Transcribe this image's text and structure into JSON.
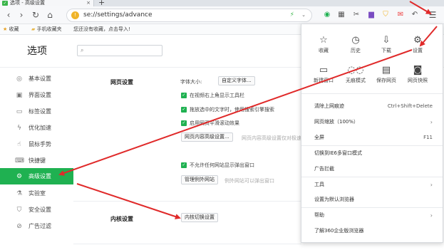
{
  "tab": {
    "title": "选项 - 高级设置",
    "close": "×",
    "new_tab": "+"
  },
  "toolbar": {
    "url": "se://settings/advance",
    "bolt": "⚡",
    "caret": "⌄",
    "icons": [
      "translate-icon",
      "scissors-icon",
      "menu-icon"
    ]
  },
  "bookmarks": {
    "favorites": "收藏",
    "mobile": "手机收藏夹",
    "hint": "您还没有收藏，点击导入!"
  },
  "page": {
    "title": "选项",
    "search_placeholder": ""
  },
  "sidebar": {
    "items": [
      {
        "label": "基本设置",
        "icon": "◎"
      },
      {
        "label": "界面设置",
        "icon": "▣"
      },
      {
        "label": "标签设置",
        "icon": "▭"
      },
      {
        "label": "优化加速",
        "icon": "ϟ"
      },
      {
        "label": "鼠标手势",
        "icon": "☝"
      },
      {
        "label": "快捷键",
        "icon": "⌨"
      },
      {
        "label": "高级设置",
        "icon": "⚙"
      },
      {
        "label": "实验室",
        "icon": "⚗"
      },
      {
        "label": "安全设置",
        "icon": "⛉"
      },
      {
        "label": "广告过滤",
        "icon": "⊘"
      }
    ]
  },
  "web_settings": {
    "title": "网页设置",
    "font_size_label": "字体大小:",
    "custom_font_btn": "自定义字体...",
    "checkboxes": [
      "在视频右上角显示工具栏",
      "拖放选中的文字时，使用搜索引擎搜索",
      "启用网页平滑滚动效果"
    ],
    "content_btn": "网页内容高级设置...",
    "content_hint": "网页内容高级设置仅对极速",
    "popup_checkbox": "不允许任何网站显示弹出窗口",
    "exceptions_btn": "管理例外网站",
    "exceptions_hint": "例外网站可以弹出窗口"
  },
  "kernel_settings": {
    "title": "内核设置",
    "switch_btn": "内核切换设置"
  },
  "menu": {
    "quick": [
      {
        "label": "收藏",
        "icon": "☆"
      },
      {
        "label": "历史",
        "icon": "◷"
      },
      {
        "label": "下载",
        "icon": "⇩"
      },
      {
        "label": "设置",
        "icon": "⚙"
      },
      {
        "label": "新建窗口",
        "icon": "▭"
      },
      {
        "label": "无痕模式",
        "icon": "◌◌"
      },
      {
        "label": "保存网页",
        "icon": "▤"
      },
      {
        "label": "网页快照",
        "icon": "◙"
      }
    ],
    "items": [
      {
        "label": "清除上网痕迹",
        "key": "Ctrl+Shift+Delete",
        "arrow": ""
      },
      {
        "label": "网页缩放（100%）",
        "key": "",
        "arrow": "›"
      },
      {
        "label": "全屏",
        "key": "F11",
        "arrow": ""
      },
      {
        "label": "切换到IE6多窗口模式",
        "key": "",
        "arrow": ""
      },
      {
        "label": "广告拦截",
        "key": "",
        "arrow": ""
      },
      {
        "label": "工具",
        "key": "",
        "arrow": "›"
      },
      {
        "label": "设置为默认浏览器",
        "key": "",
        "arrow": ""
      },
      {
        "label": "帮助",
        "key": "",
        "arrow": "›"
      },
      {
        "label": "了解360企业版浏览器",
        "key": "",
        "arrow": ""
      }
    ]
  },
  "colors": {
    "accent": "#1fb151",
    "arrow": "#e02a2a"
  }
}
